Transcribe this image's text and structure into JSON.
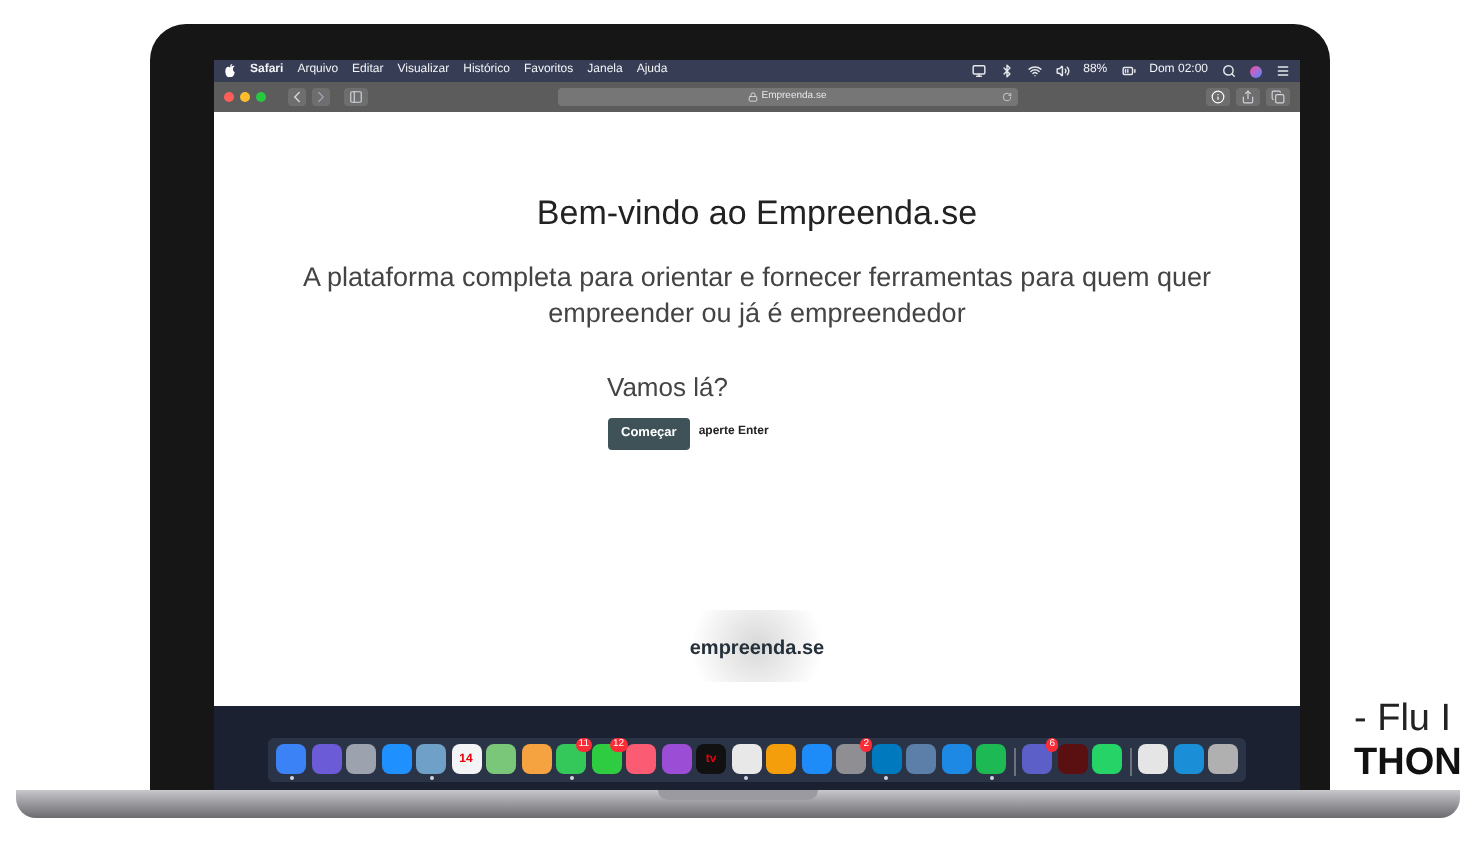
{
  "menu_bar": {
    "app": "Safari",
    "items": [
      "Arquivo",
      "Editar",
      "Visualizar",
      "Histórico",
      "Favoritos",
      "Janela",
      "Ajuda"
    ],
    "battery": "88%",
    "clock": "Dom 02:00"
  },
  "browser": {
    "address": "Empreenda.se"
  },
  "page": {
    "title": "Bem-vindo ao Empreenda.se",
    "subtitle": "A plataforma completa para orientar e fornecer ferramentas para quem quer empreender ou já é empreendedor",
    "prompt": "Vamos lá?",
    "button": "Começar",
    "hint": "aperte Enter",
    "logo": "empreenda.se"
  },
  "dock": [
    {
      "kind": "app",
      "color": "#3b82f6",
      "running": true
    },
    {
      "kind": "app",
      "color": "#6b5bd6",
      "running": false
    },
    {
      "kind": "app",
      "color": "#9ca3af",
      "running": false
    },
    {
      "kind": "app",
      "color": "#1e90ff",
      "running": false
    },
    {
      "kind": "app",
      "color": "#6fa0c8",
      "running": true
    },
    {
      "kind": "app",
      "color": "#f3f4f6",
      "label": "14",
      "running": false
    },
    {
      "kind": "app",
      "color": "#7ac77a",
      "running": false
    },
    {
      "kind": "app",
      "color": "#f4a340",
      "running": false
    },
    {
      "kind": "app",
      "color": "#34c759",
      "badge": "11",
      "running": true
    },
    {
      "kind": "app",
      "color": "#2ecc40",
      "badge": "12",
      "running": false
    },
    {
      "kind": "app",
      "color": "#fb5c74",
      "running": false
    },
    {
      "kind": "app",
      "color": "#9b4dd6",
      "running": false
    },
    {
      "kind": "app",
      "color": "#111111",
      "label": "tv",
      "running": false
    },
    {
      "kind": "app",
      "color": "#e8e8e8",
      "running": true
    },
    {
      "kind": "app",
      "color": "#f59e0b",
      "running": false
    },
    {
      "kind": "app",
      "color": "#1d8cf8",
      "running": false
    },
    {
      "kind": "app",
      "color": "#8e8e93",
      "badge": "2",
      "running": false
    },
    {
      "kind": "app",
      "color": "#0079bf",
      "running": true
    },
    {
      "kind": "app",
      "color": "#5b7fa8",
      "running": false
    },
    {
      "kind": "app",
      "color": "#1e88e5",
      "running": false
    },
    {
      "kind": "app",
      "color": "#1db954",
      "running": true
    },
    {
      "kind": "separator"
    },
    {
      "kind": "app",
      "color": "#5b5fc7",
      "badge": "6",
      "running": false
    },
    {
      "kind": "app",
      "color": "#5a1010",
      "running": false
    },
    {
      "kind": "app",
      "color": "#25d366",
      "running": false
    },
    {
      "kind": "separator"
    },
    {
      "kind": "app",
      "color": "#e5e5e5",
      "running": false
    },
    {
      "kind": "app",
      "color": "#1a8fd8",
      "running": false
    },
    {
      "kind": "app",
      "color": "#b0b0b0",
      "running": false
    }
  ],
  "side_text": {
    "line_1": "- Flu I",
    "line_2": "THON"
  }
}
